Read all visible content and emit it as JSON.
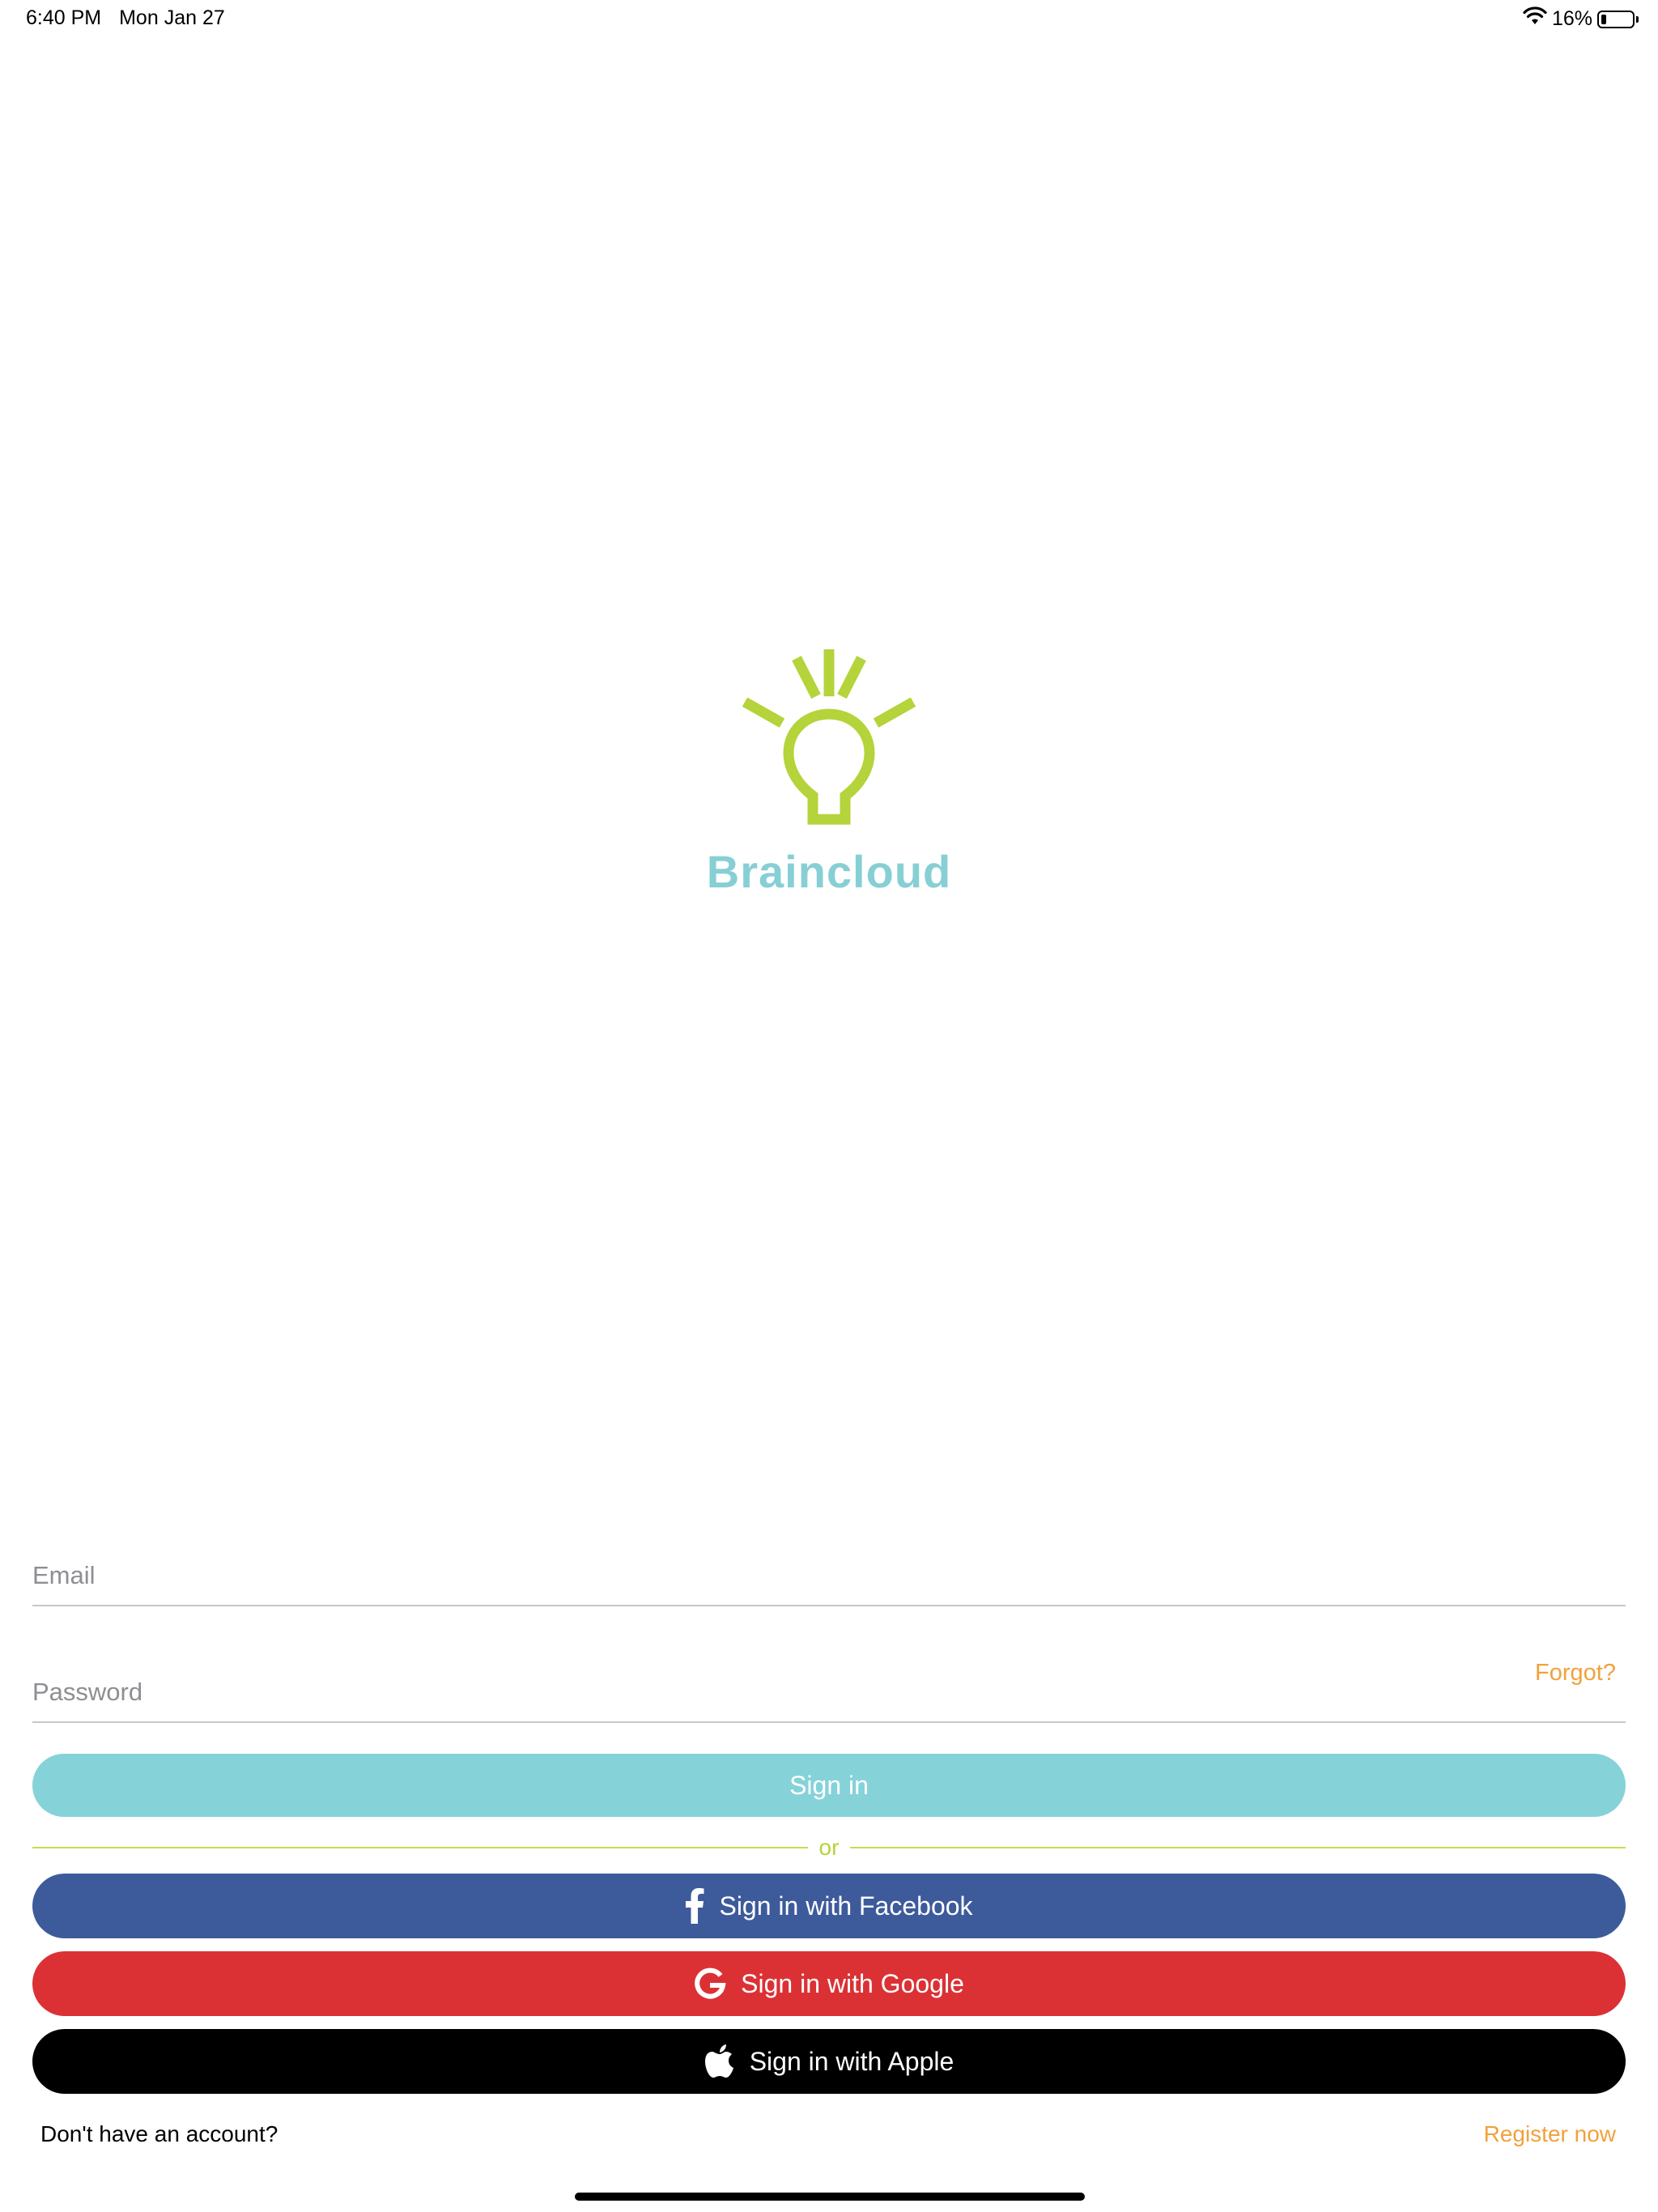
{
  "status_bar": {
    "time": "6:40 PM",
    "date": "Mon Jan 27",
    "battery_percent": "16%",
    "battery_level": 0.16,
    "wifi_icon": "wifi-icon"
  },
  "logo": {
    "brand_name": "Braincloud",
    "icon": "lightbulb-icon",
    "bulb_color": "#b5d33a",
    "text_color": "#86cfd5"
  },
  "form": {
    "email_placeholder": "Email",
    "email_value": "",
    "password_placeholder": "Password",
    "password_value": "",
    "forgot_label": "Forgot?",
    "sign_in_label": "Sign in",
    "divider_label": "or",
    "facebook_label": "Sign in with Facebook",
    "google_label": "Sign in with Google",
    "apple_label": "Sign in with Apple"
  },
  "footer": {
    "prompt": "Don't have an account?",
    "register_label": "Register now"
  },
  "colors": {
    "accent_orange": "#f2a13b",
    "sign_in_teal": "#86d2d9",
    "facebook_blue": "#3d5b9b",
    "google_red": "#db3135",
    "apple_black": "#000000",
    "divider_green": "#c6db54"
  }
}
